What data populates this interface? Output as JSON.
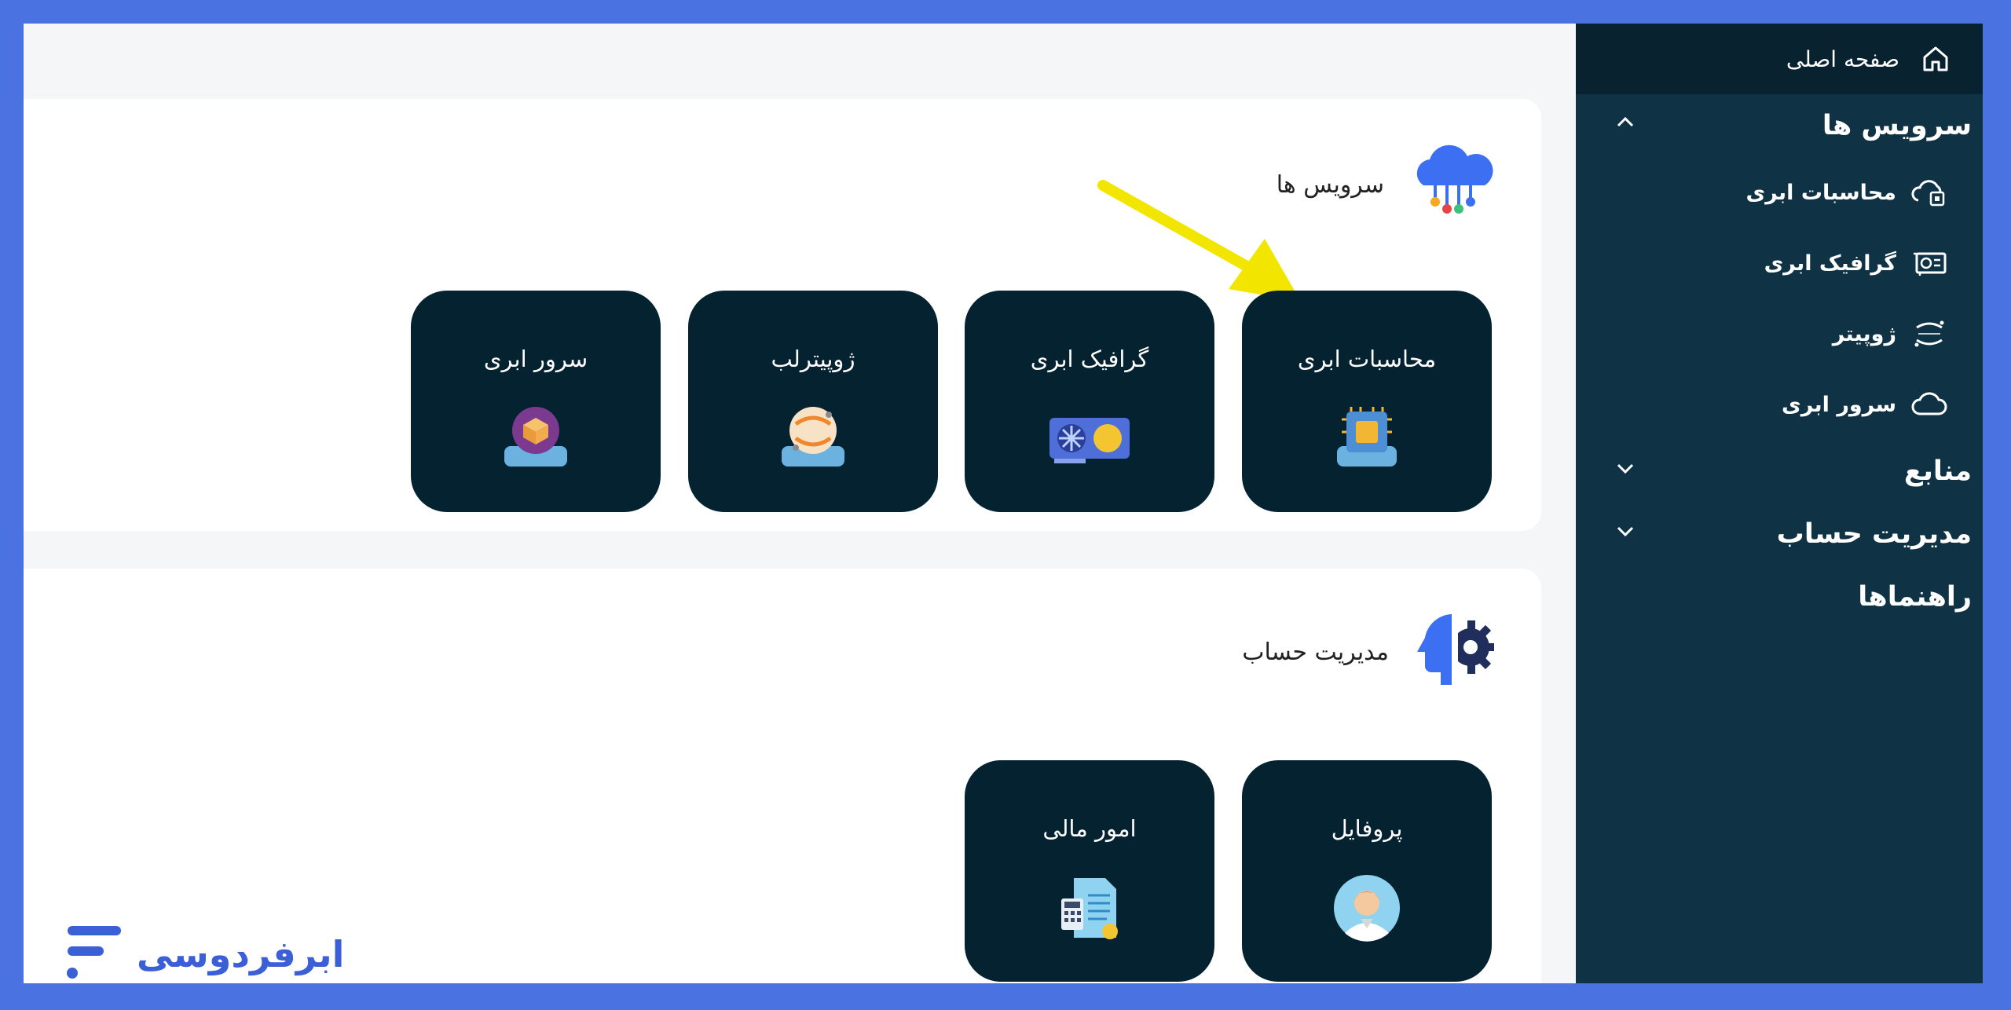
{
  "sidebar": {
    "home": "صفحه اصلی",
    "services": {
      "title": "سرویس ها",
      "items": [
        {
          "label": "محاسبات ابری",
          "icon": "cloud-compute-icon"
        },
        {
          "label": "گرافیک ابری",
          "icon": "gpu-card-icon"
        },
        {
          "label": "ژوپیتر",
          "icon": "jupyter-icon"
        },
        {
          "label": "سرور ابری",
          "icon": "cloud-icon"
        }
      ]
    },
    "resources": "منابع",
    "account": "مدیریت حساب",
    "guides": "راهنماها"
  },
  "services_panel": {
    "title": "سرویس ها",
    "tiles": [
      {
        "label": "محاسبات ابری",
        "icon": "cpu-chip-icon"
      },
      {
        "label": "گرافیک ابری",
        "icon": "graphics-card-icon"
      },
      {
        "label": "ژوپیترلب",
        "icon": "jupyterlab-icon"
      },
      {
        "label": "سرور ابری",
        "icon": "cloud-server-icon"
      }
    ]
  },
  "account_panel": {
    "title": "مدیریت حساب",
    "tiles": [
      {
        "label": "پروفایل",
        "icon": "profile-avatar-icon"
      },
      {
        "label": "امور مالی",
        "icon": "invoice-icon"
      }
    ]
  },
  "brand": {
    "name": "ابرفردوسی"
  },
  "colors": {
    "frame": "#4a72e0",
    "sidebar": "#0f3345",
    "tile": "#052231",
    "brand": "#3b5fd6",
    "arrow": "#f2e600"
  }
}
